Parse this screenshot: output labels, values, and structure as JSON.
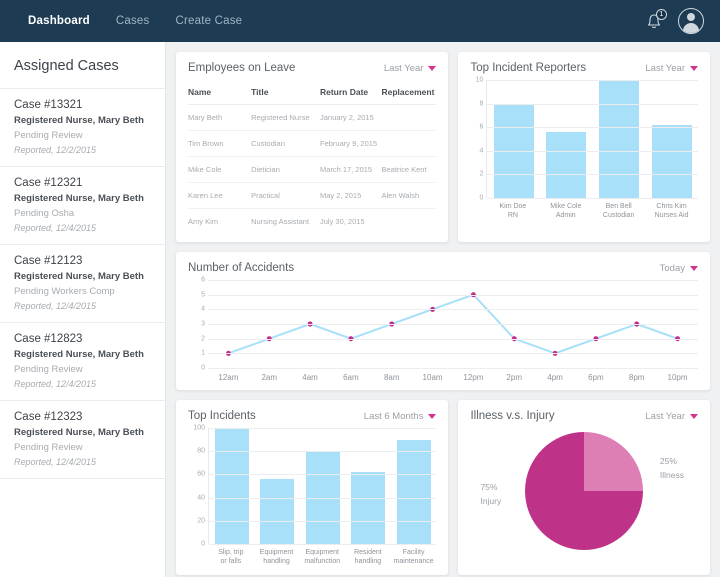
{
  "nav": {
    "links": [
      {
        "label": "Dashboard",
        "active": true
      },
      {
        "label": "Cases",
        "active": false
      },
      {
        "label": "Create Case",
        "active": false
      }
    ],
    "notification_count": "1",
    "bell_icon": "bell-icon",
    "avatar_icon": "user-avatar-icon"
  },
  "sidebar": {
    "title": "Assigned Cases",
    "cases": [
      {
        "id": "Case #13321",
        "person": "Registered Nurse, Mary Beth",
        "status": "Pending Review",
        "reported": "Reported, 12/2/2015"
      },
      {
        "id": "Case #12321",
        "person": "Registered Nurse, Mary Beth",
        "status": "Pending Osha",
        "reported": "Reported, 12/4/2015"
      },
      {
        "id": "Case #12123",
        "person": "Registered Nurse, Mary Beth",
        "status": "Pending Workers Comp",
        "reported": "Reported, 12/4/2015"
      },
      {
        "id": "Case #12823",
        "person": "Registered Nurse, Mary Beth",
        "status": "Pending Review",
        "reported": "Reported, 12/4/2015"
      },
      {
        "id": "Case #12323",
        "person": "Registered Nurse, Mary Beth",
        "status": "Pending Review",
        "reported": "Reported, 12/4/2015"
      }
    ]
  },
  "employees_on_leave": {
    "title": "Employees on Leave",
    "filter": "Last Year",
    "columns": [
      "Name",
      "Title",
      "Return Date",
      "Replacement"
    ],
    "rows": [
      [
        "Mary Beth",
        "Registered Nurse",
        "January 2, 2015",
        ""
      ],
      [
        "Tim Brown",
        "Custodian",
        "February 9, 2015",
        ""
      ],
      [
        "Mike Cole",
        "Dietician",
        "March 17, 2015",
        "Beatrice Kent"
      ],
      [
        "Karen Lee",
        "Practical",
        "May 2, 2015",
        "Alen Walsh"
      ],
      [
        "Amy Kim",
        "Nursing Assistant",
        "July 30, 2015",
        ""
      ]
    ]
  },
  "colors": {
    "navbar": "#1d3c53",
    "bar": "#a7e0f8",
    "line": "#a7e0f8",
    "point": "#c62d8a",
    "pie_major": "#be3388",
    "pie_minor": "#dd7fb4",
    "accent": "#d6338f"
  },
  "chart_data": [
    {
      "type": "bar",
      "title": "Top Incident Reporters",
      "filter": "Last Year",
      "categories": [
        "Kim Doe\nRN",
        "Mike Cole\nAdmin",
        "Ben Bell\nCustodian",
        "Chris Kim\nNurses Aid"
      ],
      "category_lines": [
        [
          "Kim Doe",
          "RN"
        ],
        [
          "Mike Cole",
          "Admin"
        ],
        [
          "Ben Bell",
          "Custodian"
        ],
        [
          "Chris Kim",
          "Nurses Aid"
        ]
      ],
      "values": [
        8,
        5.6,
        10,
        6.2
      ],
      "yticks": [
        0,
        2,
        4,
        6,
        8,
        10
      ],
      "ylim": [
        0,
        10
      ],
      "xlabel": "",
      "ylabel": "",
      "grid": true,
      "legend": "none"
    },
    {
      "type": "line",
      "title": "Number of Accidents",
      "filter": "Today",
      "x": [
        "12am",
        "2am",
        "4am",
        "6am",
        "8am",
        "10am",
        "12pm",
        "2pm",
        "4pm",
        "6pm",
        "8pm",
        "10pm"
      ],
      "values": [
        1,
        2,
        3,
        2,
        3,
        4,
        5,
        2,
        1,
        2,
        3,
        2
      ],
      "yticks": [
        0,
        1,
        2,
        3,
        4,
        5,
        6
      ],
      "ylim": [
        0,
        6
      ],
      "xlabel": "",
      "ylabel": "",
      "grid": true,
      "legend": "none"
    },
    {
      "type": "bar",
      "title": "Top Incidents",
      "filter": "Last 6 Months",
      "categories": [
        "Slip, trip or falls",
        "Equipment handling",
        "Equipment malfunction",
        "Resident handling",
        "Facility maintenance"
      ],
      "category_lines": [
        [
          "Slip, trip",
          "or falls"
        ],
        [
          "Equipment",
          "handling"
        ],
        [
          "Equipment",
          "malfunction"
        ],
        [
          "Resident",
          "handling"
        ],
        [
          "Facility",
          "maintenance"
        ]
      ],
      "values": [
        100,
        56,
        80,
        62,
        90
      ],
      "yticks": [
        0,
        20,
        40,
        60,
        80,
        100
      ],
      "ylim": [
        0,
        100
      ],
      "xlabel": "",
      "ylabel": "",
      "grid": true,
      "legend": "none"
    },
    {
      "type": "pie",
      "title": "Illness v.s. Injury",
      "filter": "Last Year",
      "labels": [
        "Injury",
        "Illness"
      ],
      "values": [
        75,
        25
      ],
      "value_labels": [
        "75%",
        "25%"
      ],
      "colors": [
        "#be3388",
        "#dd7fb4"
      ],
      "legend": "inline-labels"
    }
  ]
}
